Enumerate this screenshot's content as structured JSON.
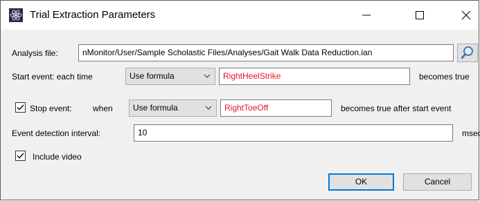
{
  "window": {
    "title": "Trial Extraction Parameters"
  },
  "analysis_file": {
    "label": "Analysis file:",
    "value": "nMonitor/User/Sample Scholastic Files/Analyses/Gait Walk Data Reduction.ian"
  },
  "start_event": {
    "label": "Start event: each time",
    "mode": "Use formula",
    "formula": "RightHeelStrike",
    "suffix": "becomes true"
  },
  "stop_event": {
    "checked": true,
    "label": "Stop event:",
    "when_label": "when",
    "mode": "Use formula",
    "formula": "RightToeOff",
    "suffix": "becomes true after start event"
  },
  "detection_interval": {
    "label": "Event detection interval:",
    "value": "10",
    "unit": "msec"
  },
  "include_video": {
    "checked": true,
    "label": "Include video"
  },
  "buttons": {
    "ok": "OK",
    "cancel": "Cancel"
  },
  "colors": {
    "formula_text": "#e81123",
    "default_button_border": "#0078d7"
  },
  "icons": {
    "app": "app-icon",
    "search": "magnifier-icon"
  }
}
